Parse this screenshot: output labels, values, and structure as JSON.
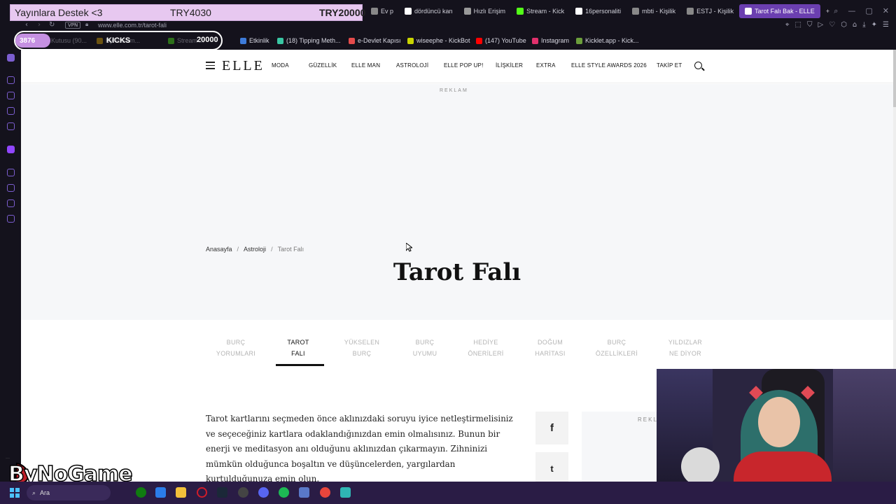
{
  "stream_overlay": {
    "donation_label": "Yayınlara Destek <3",
    "donation_current": "TRY4030",
    "donation_goal": "TRY20000",
    "viewer_count": "3876",
    "kicks_label": "KICKS",
    "kicks_count": "20000",
    "brand": "ByNoGame"
  },
  "browser": {
    "url": "www.elle.com.tr/tarot-fali",
    "vpn_label": "VPN",
    "tabs": [
      {
        "label": "Ev p",
        "icon": "generic-icon",
        "color": "#888888"
      },
      {
        "label": "dördüncü kan",
        "icon": "google-icon",
        "color": "#ffffff"
      },
      {
        "label": "Hızlı Erişim",
        "icon": "grid-icon",
        "color": "#999999"
      },
      {
        "label": "Stream - Kick",
        "icon": "kick-icon",
        "color": "#53fc18"
      },
      {
        "label": "16personaliti",
        "icon": "google-icon",
        "color": "#ffffff"
      },
      {
        "label": "mbti - Kişilik",
        "icon": "generic-icon",
        "color": "#888888"
      },
      {
        "label": "ESTJ - Kişilik",
        "icon": "generic-icon",
        "color": "#888888"
      },
      {
        "label": "Tarot Falı Bak - ELLE",
        "icon": "elle-icon",
        "color": "#ffffff",
        "active": true
      }
    ],
    "bookmarks": [
      {
        "label": "Kutusu (90...",
        "icon": "generic-icon",
        "color": "#888888"
      },
      {
        "label": "ByNoGam...",
        "icon": "bynogame-icon",
        "color": "#f0b400"
      },
      {
        "label": "Stream ...",
        "icon": "kick-icon",
        "color": "#53fc18"
      },
      {
        "label": "Etkinlik",
        "icon": "a-icon",
        "color": "#3d7bd9"
      },
      {
        "label": "(18) Tipping Meth...",
        "icon": "t-icon",
        "color": "#39c6a3"
      },
      {
        "label": "e-Devlet Kapısı",
        "icon": "edevlet-icon",
        "color": "#e54b4b"
      },
      {
        "label": "wiseephe - KickBot",
        "icon": "kickbot-icon",
        "color": "#c9d400"
      },
      {
        "label": "(147) YouTube",
        "icon": "youtube-icon",
        "color": "#ff0000"
      },
      {
        "label": "Instagram",
        "icon": "instagram-icon",
        "color": "#e1306c"
      },
      {
        "label": "Kicklet.app - Kick...",
        "icon": "kicklet-icon",
        "color": "#6b9e3b"
      }
    ]
  },
  "site": {
    "logo": "ELLE",
    "menu": [
      "MODA",
      "GÜZELLİK",
      "ELLE MAN",
      "ASTROLOJİ",
      "ELLE POP UP!",
      "İLİŞKİLER",
      "EXTRA",
      "ELLE STYLE AWARDS 2026",
      "TAKİP ET"
    ],
    "ad_label": "REKLAM",
    "side_ad_label": "REKL",
    "breadcrumb": [
      "Anasayfa",
      "Astroloji",
      "Tarot Falı"
    ],
    "page_title": "Tarot Falı",
    "subnav": [
      {
        "line1": "BURÇ",
        "line2": "YORUMLARI"
      },
      {
        "line1": "TAROT",
        "line2": "FALI",
        "active": true
      },
      {
        "line1": "YÜKSELEN",
        "line2": "BURÇ"
      },
      {
        "line1": "BURÇ",
        "line2": "UYUMU"
      },
      {
        "line1": "HEDİYE",
        "line2": "ÖNERİLERİ"
      },
      {
        "line1": "DOĞUM",
        "line2": "HARİTASI"
      },
      {
        "line1": "BURÇ",
        "line2": "ÖZELLİKLERİ"
      },
      {
        "line1": "YILDIZLAR",
        "line2": "NE DİYOR"
      }
    ],
    "article_text": "Tarot kartlarını seçmeden önce aklınızdaki soruyu iyice netleştirmelisiniz ve seçeceğiniz kartlara odaklandığınızdan emin olmalısınız. Bunun bir enerji ve meditasyon anı olduğunu aklınızdan çıkarmayın. Zihninizi mümkün olduğunca boşaltın ve düşüncelerden, yargılardan kurtulduğunuza emin olun.",
    "share": {
      "facebook": "f",
      "twitter": "t"
    }
  },
  "taskbar": {
    "search_placeholder": "Ara"
  }
}
